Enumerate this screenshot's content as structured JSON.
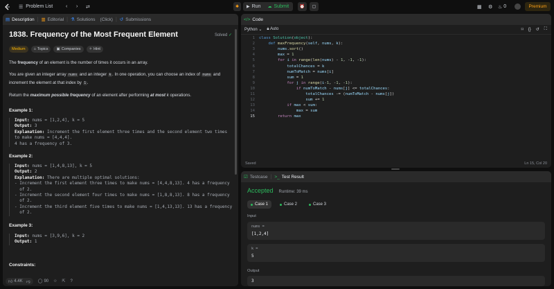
{
  "topbar": {
    "problem_list": "Problem List",
    "run": "Run",
    "submit": "Submit",
    "coins": "0",
    "premium": "Premium"
  },
  "left_tabs": {
    "description": "Description",
    "editorial": "Editorial",
    "solutions": "Solutions",
    "click": "(Click)",
    "submissions": "Submissions"
  },
  "problem": {
    "title": "1838. Frequency of the Most Frequent Element",
    "solved": "Solved",
    "difficulty": "Medium",
    "tags": [
      "Topics",
      "Companies",
      "Hint"
    ],
    "p1_pre": "The ",
    "p1_bold": "frequency",
    "p1_post": " of an element is the number of times it occurs in an array.",
    "p2_a": "You are given an integer array ",
    "p2_nums": "nums",
    "p2_b": " and an integer ",
    "p2_k": "k",
    "p2_c": ". In one operation, you can choose an index of ",
    "p2_nums2": "nums",
    "p2_d": " and",
    "p2_e": "increment the element at that index by ",
    "p2_one": "1",
    "p2_f": ".",
    "p3_a": "Return the ",
    "p3_bold1": "maximum possible frequency",
    "p3_b": " of an element after performing ",
    "p3_bold2": "at most",
    "p3_c": " k",
    "p3_d": " operations."
  },
  "examples": [
    {
      "heading": "Example 1:",
      "input": "nums = [1,2,4], k = 5",
      "output": "3",
      "explanation": "Increment the first element three times and the second element two times",
      "extra": [
        "to make nums = [4,4,4].",
        "4 has a frequency of 3."
      ]
    },
    {
      "heading": "Example 2:",
      "input": "nums = [1,4,8,13], k = 5",
      "output": "2",
      "explanation": "There are multiple optimal solutions:",
      "extra": [
        "- Increment the first element three times to make nums = [4,4,8,13]. 4 has a frequency",
        "  of 2.",
        "- Increment the second element four times to make nums = [1,8,8,13]. 8 has a frequency",
        "  of 2.",
        "- Increment the third element five times to make nums = [1,4,13,13]. 13 has a frequency",
        "  of 2."
      ]
    },
    {
      "heading": "Example 3:",
      "input": "nums = [3,9,6], k = 2",
      "output": "1",
      "explanation": "",
      "extra": []
    }
  ],
  "labels": {
    "input": "Input:",
    "output": "Output:",
    "explanation": "Explanation:",
    "constraints": "Constraints:"
  },
  "footer": {
    "likes": "4.4K",
    "comments": "90"
  },
  "code_panel": {
    "title": "Code",
    "language": "Python",
    "mode": "Auto",
    "saved": "Saved",
    "cursor": "Ln 15, Col 20",
    "lines": [
      "class Solution(object):",
      "    def maxFrequency(self, nums, k):",
      "        nums.sort()",
      "        max = 1",
      "        for i in range(len(nums) - 1, -1, -1):",
      "            totalChances = k",
      "            numToMatch = nums[i]",
      "            sum = 1",
      "            for j in range(i-1, -1, -1):",
      "                if numToMatch - nums[j] <= totalChances:",
      "                    totalChances -= (numToMatch - nums[j])",
      "                    sum += 1",
      "            if max < sum:",
      "                max = sum",
      "        return max"
    ]
  },
  "result_panel": {
    "tab_testcase": "Testcase",
    "tab_result": "Test Result",
    "status": "Accepted",
    "runtime": "Runtime: 39 ms",
    "cases": [
      "Case 1",
      "Case 2",
      "Case 3"
    ],
    "input_label": "Input",
    "output_label": "Output",
    "vars": [
      {
        "name": "nums =",
        "value": "[1,2,4]"
      },
      {
        "name": "k =",
        "value": "5"
      }
    ],
    "output_value": "3"
  },
  "colors": {
    "accepted": "#2cbb5d",
    "premium": "#ffa116",
    "medium": "#ffb800"
  }
}
